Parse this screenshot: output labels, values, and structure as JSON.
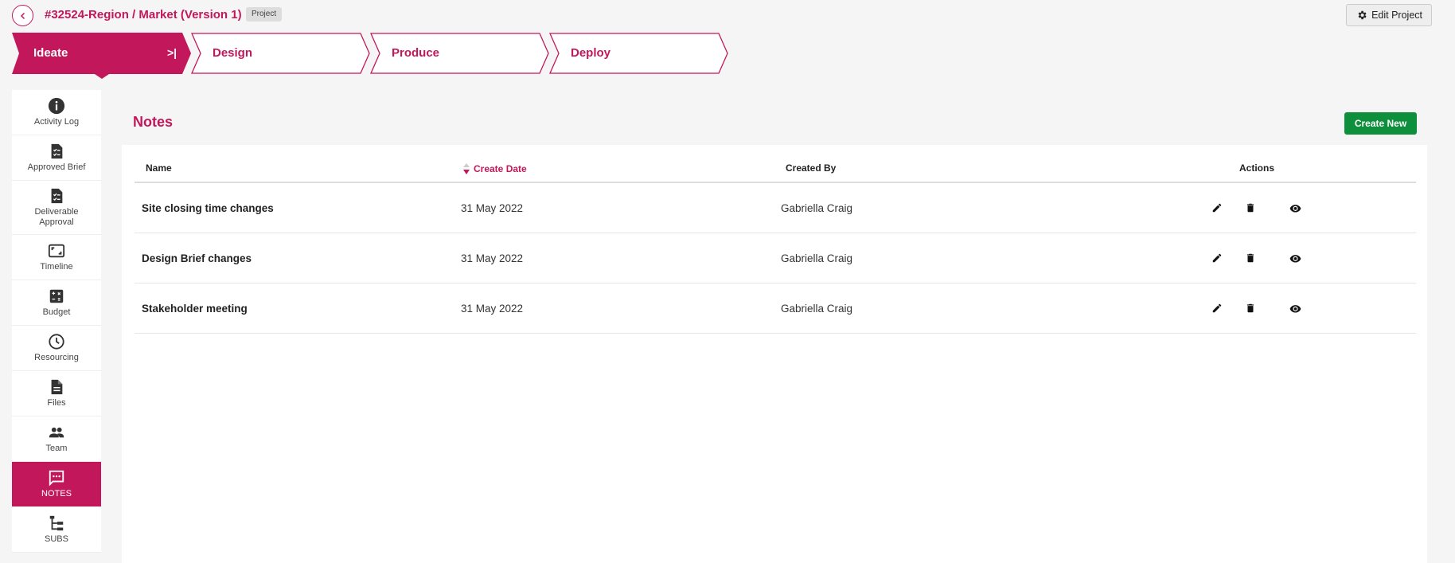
{
  "header": {
    "title": "#32524-Region / Market (Version 1)",
    "badge": "Project",
    "edit_label": "Edit Project"
  },
  "steps": [
    {
      "label": "Ideate",
      "active": true,
      "collapse": ">|"
    },
    {
      "label": "Design",
      "active": false
    },
    {
      "label": "Produce",
      "active": false
    },
    {
      "label": "Deploy",
      "active": false
    }
  ],
  "sidebar": {
    "items": [
      {
        "label": "Activity Log",
        "icon": "info-icon"
      },
      {
        "label": "Approved Brief",
        "icon": "checklist-doc-icon"
      },
      {
        "label": "Deliverable Approval",
        "icon": "checklist-doc-icon"
      },
      {
        "label": "Timeline",
        "icon": "aspect-frame-icon"
      },
      {
        "label": "Budget",
        "icon": "calculator-icon"
      },
      {
        "label": "Resourcing",
        "icon": "clock-icon"
      },
      {
        "label": "Files",
        "icon": "file-icon"
      },
      {
        "label": "Team",
        "icon": "people-icon"
      },
      {
        "label": "NOTES",
        "icon": "chat-bubble-icon",
        "active": true
      },
      {
        "label": "SUBS",
        "icon": "tree-list-icon"
      }
    ]
  },
  "notes": {
    "title": "Notes",
    "create_label": "Create New",
    "columns": {
      "name": "Name",
      "create_date": "Create Date",
      "created_by": "Created By",
      "actions": "Actions"
    },
    "rows": [
      {
        "name": "Site closing time changes",
        "date": "31 May 2022",
        "by": "Gabriella Craig"
      },
      {
        "name": "Design Brief changes",
        "date": "31 May 2022",
        "by": "Gabriella Craig"
      },
      {
        "name": "Stakeholder meeting",
        "date": "31 May 2022",
        "by": "Gabriella Craig"
      }
    ]
  },
  "colors": {
    "accent": "#c2185b",
    "create_button": "#0e8f3c"
  }
}
